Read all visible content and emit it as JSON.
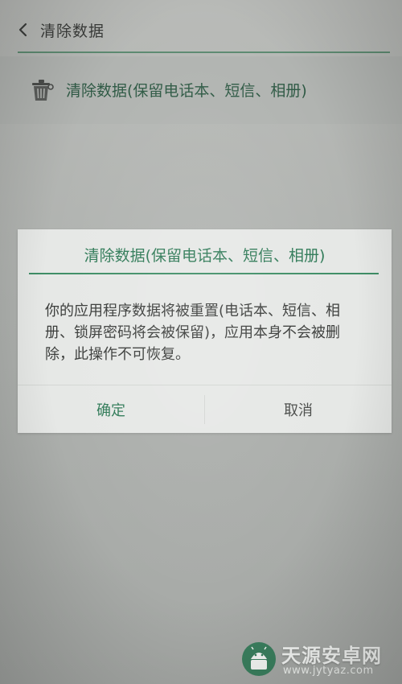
{
  "header": {
    "title": "清除数据",
    "back_icon": "chevron-left-icon"
  },
  "option": {
    "label": "清除数据(保留电话本、短信、相册)",
    "icon": "trash-icon"
  },
  "dialog": {
    "title": "清除数据(保留电话本、短信、相册)",
    "message": "你的应用程序数据将被重置(电话本、短信、相册、锁屏密码将会被保留)，应用本身不会被删除，此操作不可恢复。",
    "ok_label": "确定",
    "cancel_label": "取消"
  },
  "watermark": {
    "name": "天源安卓网",
    "url": "www.jytyaz.com"
  },
  "colors": {
    "accent_green": "#2f7a57",
    "divider_green": "#3f8e66",
    "dialog_bg": "#e6e8e6"
  }
}
